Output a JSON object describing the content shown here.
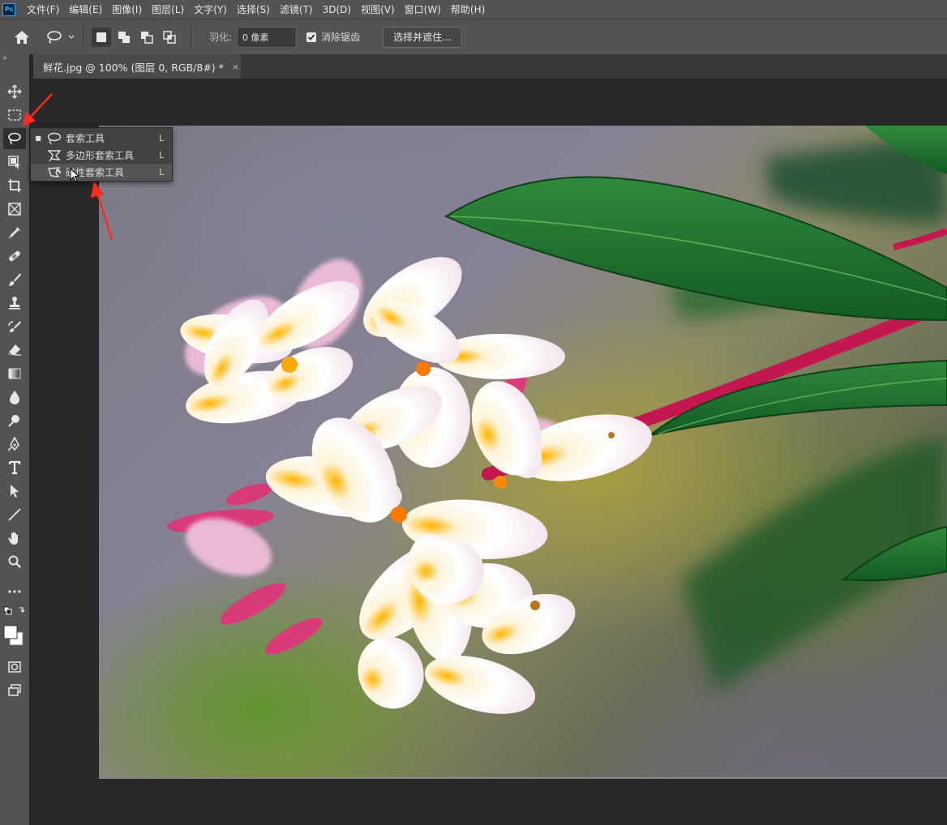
{
  "app": {
    "logo": "Ps"
  },
  "menu": [
    "文件(F)",
    "编辑(E)",
    "图像(I)",
    "图层(L)",
    "文字(Y)",
    "选择(S)",
    "滤镜(T)",
    "3D(D)",
    "视图(V)",
    "窗口(W)",
    "帮助(H)"
  ],
  "options": {
    "feather_label": "羽化:",
    "feather_value": "0 像素",
    "antialias_label": "消除锯齿",
    "antialias_checked": true,
    "select_mask_label": "选择并遮住..."
  },
  "document": {
    "tab_title": "鲜花.jpg @ 100% (图层 0, RGB/8#) *",
    "close_glyph": "×"
  },
  "toolbar": {
    "collapse_glyph": "»",
    "active_tool": "lasso-tool"
  },
  "flyout": {
    "items": [
      {
        "label": "套索工具",
        "shortcut": "L",
        "selected": true,
        "icon": "lasso-icon"
      },
      {
        "label": "多边形套索工具",
        "shortcut": "L",
        "selected": false,
        "icon": "polygonal-lasso-icon"
      },
      {
        "label": "磁性套索工具",
        "shortcut": "L",
        "selected": false,
        "icon": "magnetic-lasso-icon",
        "hovered": true
      }
    ]
  },
  "colors": {
    "ui_panel": "#535353",
    "ui_dark": "#282828",
    "annotation": "#ff2a1a",
    "ps_blue": "#31a8ff"
  }
}
